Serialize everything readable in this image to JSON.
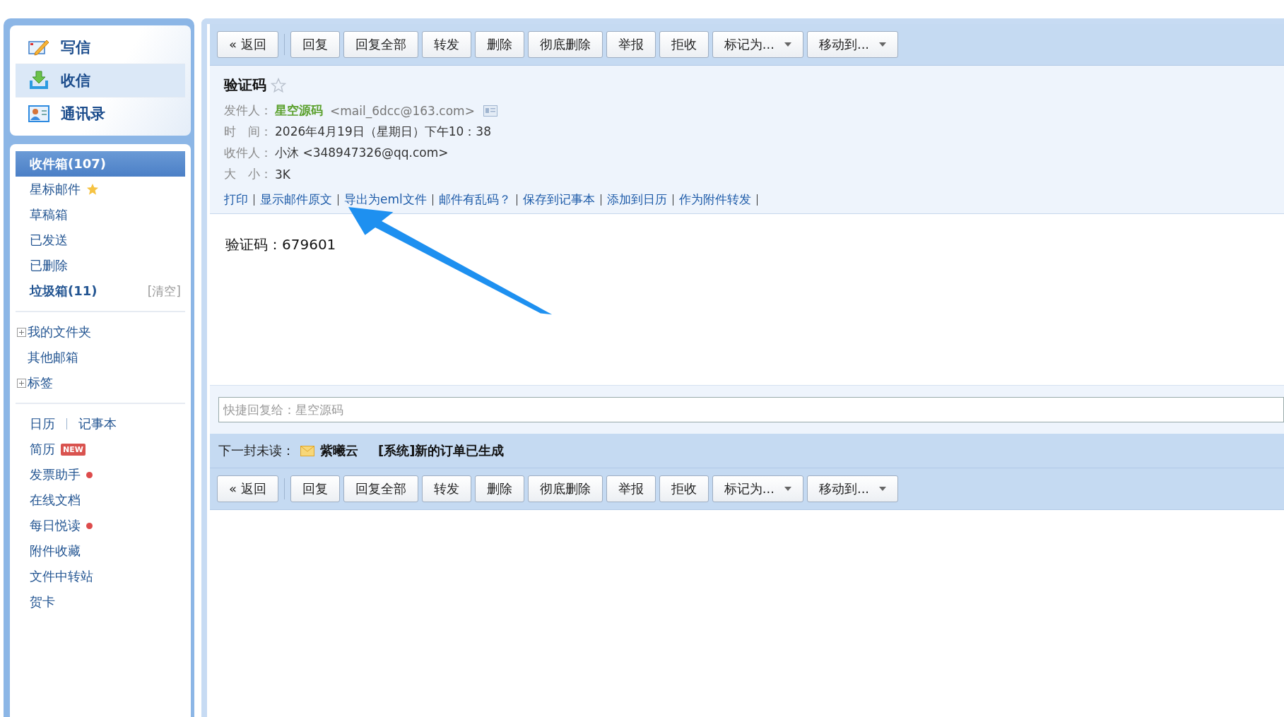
{
  "sidebar": {
    "nav": [
      {
        "label": "写信",
        "selected": false
      },
      {
        "label": "收信",
        "selected": true
      },
      {
        "label": "通讯录",
        "selected": false
      }
    ],
    "folders": [
      {
        "label": "收件箱(107)",
        "selected": true,
        "bold": true,
        "starred": false
      },
      {
        "label": "星标邮件",
        "selected": false,
        "bold": false,
        "starred": true
      },
      {
        "label": "草稿箱",
        "selected": false,
        "bold": false,
        "starred": false
      },
      {
        "label": "已发送",
        "selected": false,
        "bold": false,
        "starred": false
      },
      {
        "label": "已删除",
        "selected": false,
        "bold": false,
        "starred": false
      },
      {
        "label": "垃圾箱(11)",
        "selected": false,
        "bold": true,
        "starred": false,
        "action": "[清空]"
      }
    ],
    "groups": [
      {
        "label": "我的文件夹",
        "kind": "tree",
        "expanded": false
      },
      {
        "label": "其他邮箱",
        "kind": "plain"
      },
      {
        "label": "标签",
        "kind": "tree",
        "expanded": false
      }
    ],
    "apps": [
      {
        "links": [
          "日历",
          "记事本"
        ],
        "new_badge": false,
        "dot": false
      },
      {
        "links": [
          "简历"
        ],
        "new_badge": true,
        "badge_text": "NEW",
        "dot": false
      },
      {
        "links": [
          "发票助手"
        ],
        "new_badge": false,
        "dot": true
      },
      {
        "links": [
          "在线文档"
        ],
        "new_badge": false,
        "dot": false
      },
      {
        "links": [
          "每日悦读"
        ],
        "new_badge": false,
        "dot": true
      },
      {
        "links": [
          "附件收藏"
        ],
        "new_badge": false,
        "dot": false
      },
      {
        "links": [
          "文件中转站"
        ],
        "new_badge": false,
        "dot": false
      },
      {
        "links": [
          "贺卡"
        ],
        "new_badge": false,
        "dot": false
      }
    ]
  },
  "toolbar_top": [
    {
      "label": "« 返回",
      "kind": "back"
    },
    {
      "label": "回复",
      "kind": "button"
    },
    {
      "label": "回复全部",
      "kind": "button"
    },
    {
      "label": "转发",
      "kind": "button"
    },
    {
      "label": "删除",
      "kind": "button"
    },
    {
      "label": "彻底删除",
      "kind": "button"
    },
    {
      "label": "举报",
      "kind": "button"
    },
    {
      "label": "拒收",
      "kind": "button"
    },
    {
      "label": "标记为...",
      "kind": "dropdown"
    },
    {
      "label": "移动到...",
      "kind": "dropdown"
    }
  ],
  "message": {
    "subject": "验证码",
    "starred": false,
    "fields": [
      {
        "label": "发件人：",
        "kind": "sender",
        "name": "星空源码",
        "value": "<mail_6dcc@163.com>"
      },
      {
        "label": "时　间：",
        "kind": "plain",
        "value": "2026年4月19日（星期日）下午10：38"
      },
      {
        "label": "收件人：",
        "kind": "plain",
        "value": "小沐 <348947326@qq.com>"
      },
      {
        "label": "大　小：",
        "kind": "plain",
        "value": "3K"
      }
    ],
    "actions": [
      "打印",
      "显示邮件原文",
      "导出为eml文件",
      "邮件有乱码？",
      "保存到记事本",
      "添加到日历",
      "作为附件转发"
    ],
    "body": "验证码：679601"
  },
  "quick_reply": {
    "placeholder": "快捷回复给：星空源码"
  },
  "next_unread": {
    "label": "下一封未读：",
    "sender": "紫曦云",
    "subject": "[系统]新的订单已生成"
  },
  "toolbar_bottom": [
    {
      "label": "« 返回",
      "kind": "back"
    },
    {
      "label": "回复",
      "kind": "button"
    },
    {
      "label": "回复全部",
      "kind": "button"
    },
    {
      "label": "转发",
      "kind": "button"
    },
    {
      "label": "删除",
      "kind": "button"
    },
    {
      "label": "彻底删除",
      "kind": "button"
    },
    {
      "label": "举报",
      "kind": "button"
    },
    {
      "label": "拒收",
      "kind": "button"
    },
    {
      "label": "标记为...",
      "kind": "dropdown"
    },
    {
      "label": "移动到...",
      "kind": "dropdown"
    }
  ]
}
